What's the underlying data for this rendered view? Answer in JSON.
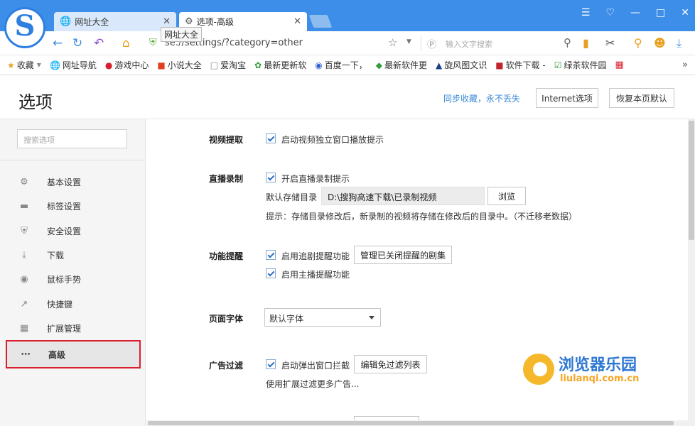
{
  "colors": {
    "titlebar": "#3d8ee8",
    "accent": "#3a8ad8",
    "highlight_border": "#d9202f"
  },
  "tooltip": "网址大全",
  "tabs": [
    {
      "title": "网址大全",
      "icon": "globe-icon"
    },
    {
      "title": "选项-高级",
      "icon": "gear-icon"
    }
  ],
  "address": {
    "url": "se://settings/?category=other"
  },
  "search": {
    "placeholder": "输入文字搜索"
  },
  "bookmarks": [
    {
      "label": "收藏",
      "icon": "star-icon"
    },
    {
      "label": "网址导航",
      "icon": "globe-icon"
    },
    {
      "label": "游戏中心",
      "icon": "game-icon"
    },
    {
      "label": "小说大全",
      "icon": "book-icon"
    },
    {
      "label": "爱淘宝",
      "icon": "page-icon"
    },
    {
      "label": "最新更新软",
      "icon": "leaf-icon"
    },
    {
      "label": "百度一下，",
      "icon": "paw-icon"
    },
    {
      "label": "最新软件更",
      "icon": "e6-icon"
    },
    {
      "label": "旋风图文识",
      "icon": "bird-icon"
    },
    {
      "label": "软件下载 -",
      "icon": "b3-icon"
    },
    {
      "label": "绿茶软件园",
      "icon": "check-icon"
    }
  ],
  "header": {
    "title": "选项",
    "sync_link": "同步收藏，永不丢失",
    "internet_button": "Internet选项",
    "restore_button": "恢复本页默认"
  },
  "sidebar": {
    "search_placeholder": "搜索选项",
    "items": [
      {
        "label": "基本设置",
        "icon": "gear-icon"
      },
      {
        "label": "标签设置",
        "icon": "tab-icon"
      },
      {
        "label": "安全设置",
        "icon": "shield-icon"
      },
      {
        "label": "下载",
        "icon": "download-icon"
      },
      {
        "label": "鼠标手势",
        "icon": "mouse-icon"
      },
      {
        "label": "快捷键",
        "icon": "shortcut-icon"
      },
      {
        "label": "扩展管理",
        "icon": "grid-icon"
      },
      {
        "label": "高级",
        "icon": "more-icon"
      }
    ]
  },
  "sections": {
    "video": {
      "label": "视频提取",
      "option": "启动视频独立窗口播放提示"
    },
    "live": {
      "label": "直播录制",
      "option": "开启直播录制提示",
      "dir_label": "默认存储目录",
      "dir_value": "D:\\搜狗高速下载\\已录制视频",
      "browse": "浏览",
      "hint": "提示：存储目录修改后，新录制的视频将存储在修改后的目录中。（不迁移老数据）"
    },
    "reminder": {
      "label": "功能提醒",
      "option1": "启用追剧提醒功能",
      "manage_button": "管理已关闭提醒的剧集",
      "option2": "启用主播提醒功能"
    },
    "font": {
      "label": "页面字体",
      "selected": "默认字体"
    },
    "adblock": {
      "label": "广告过滤",
      "option": "启动弹出窗口拦截",
      "edit_button": "编辑免过滤列表",
      "note": "使用扩展过滤更多广告..."
    }
  },
  "watermark": {
    "title": "浏览器乐园",
    "url": "liulanqi.com.cn"
  }
}
